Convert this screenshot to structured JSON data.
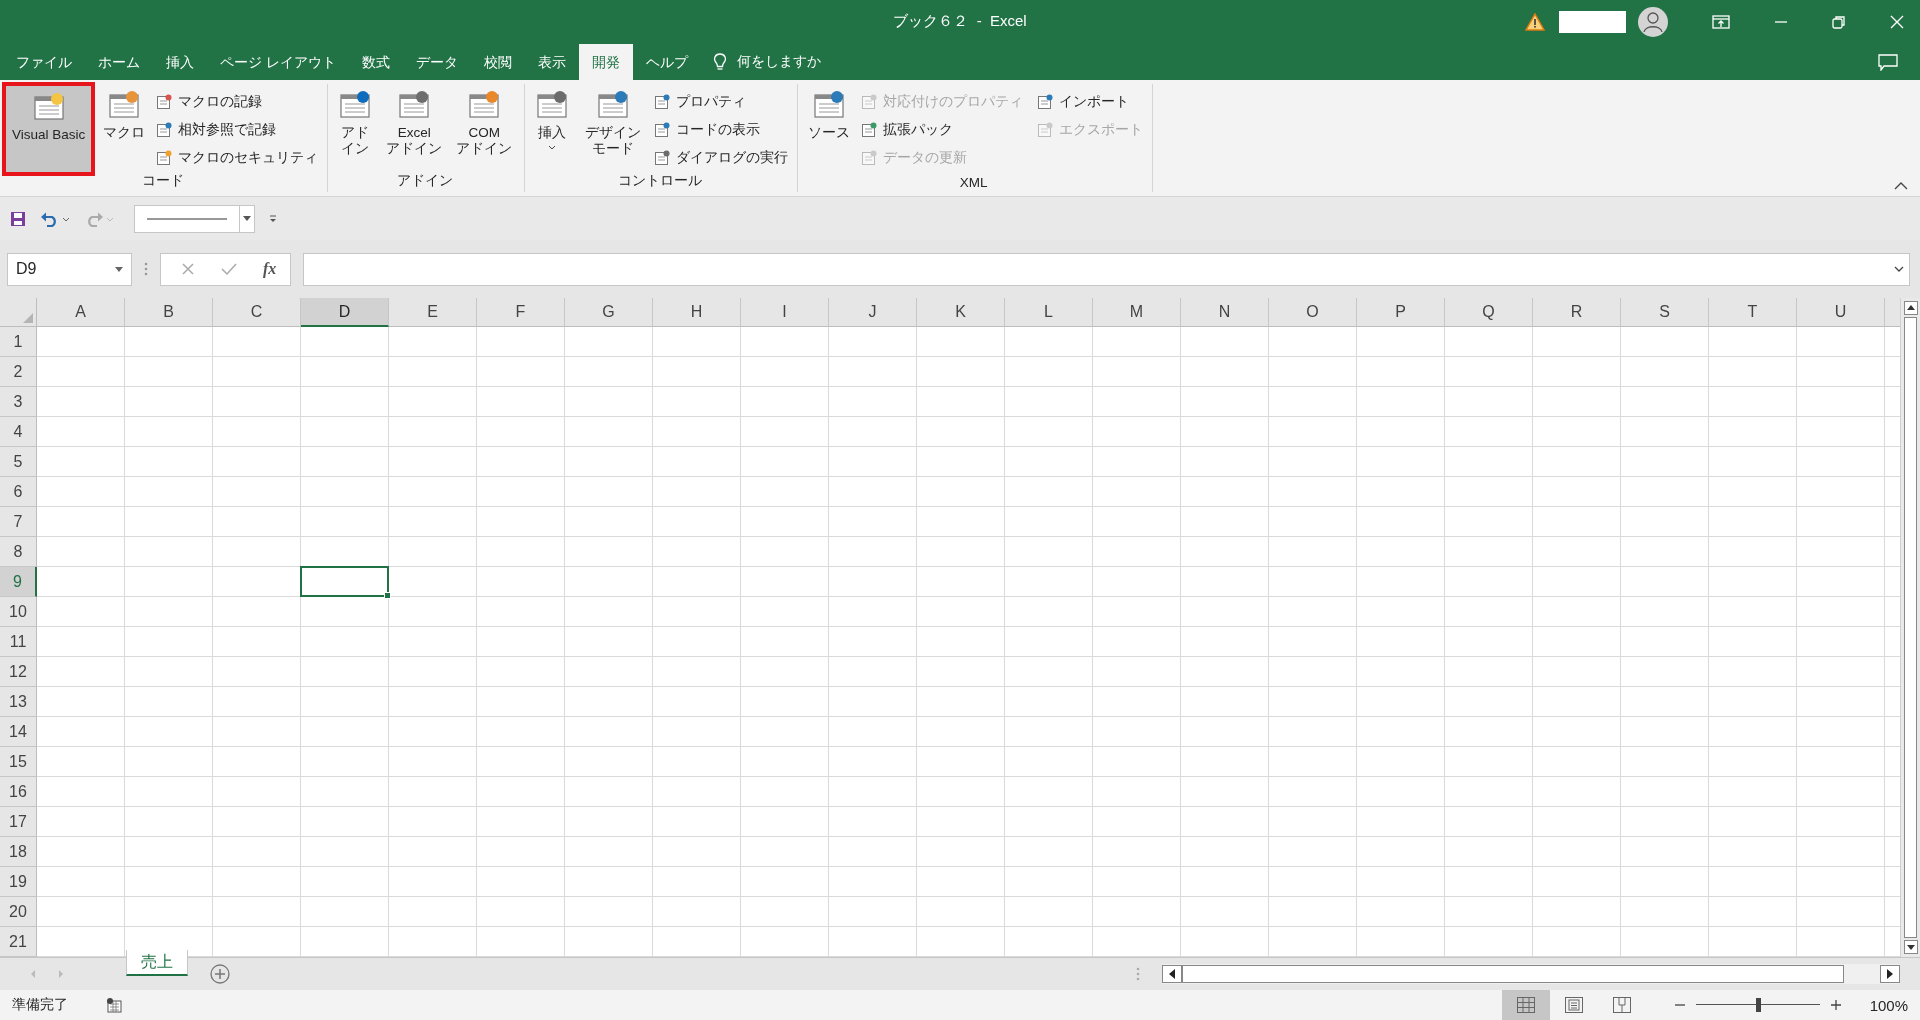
{
  "window": {
    "title": "ブック６２  -  Excel"
  },
  "tabs": [
    {
      "label": "ファイル",
      "selected": false
    },
    {
      "label": "ホーム",
      "selected": false
    },
    {
      "label": "挿入",
      "selected": false
    },
    {
      "label": "ページ レイアウト",
      "selected": false
    },
    {
      "label": "数式",
      "selected": false
    },
    {
      "label": "データ",
      "selected": false
    },
    {
      "label": "校閲",
      "selected": false
    },
    {
      "label": "表示",
      "selected": false
    },
    {
      "label": "開発",
      "selected": true
    },
    {
      "label": "ヘルプ",
      "selected": false
    }
  ],
  "tell_me": "何をしますか",
  "ribbon_groups": [
    {
      "label": "コード",
      "items": [
        {
          "kind": "large",
          "label": "Visual Basic",
          "highlighted": true,
          "disabled": false,
          "dropdown": false
        },
        {
          "kind": "large",
          "label": "マクロ",
          "highlighted": false,
          "disabled": false,
          "dropdown": false
        },
        {
          "kind": "small",
          "label": "マクロの記録",
          "highlighted": false,
          "disabled": false,
          "dropdown": false
        },
        {
          "kind": "small",
          "label": "相対参照で記録",
          "highlighted": false,
          "disabled": false,
          "dropdown": false
        },
        {
          "kind": "small",
          "label": "マクロのセキュリティ",
          "highlighted": false,
          "disabled": false,
          "dropdown": false
        }
      ]
    },
    {
      "label": "アドイン",
      "items": [
        {
          "kind": "large",
          "label": "アドイン",
          "highlighted": false,
          "disabled": false,
          "dropdown": false
        },
        {
          "kind": "large",
          "label": "Excel\nアドイン",
          "highlighted": false,
          "disabled": false,
          "dropdown": false
        },
        {
          "kind": "large",
          "label": "COM\nアドイン",
          "highlighted": false,
          "disabled": false,
          "dropdown": false
        }
      ]
    },
    {
      "label": "コントロール",
      "items": [
        {
          "kind": "large",
          "label": "挿入",
          "highlighted": false,
          "disabled": false,
          "dropdown": true
        },
        {
          "kind": "large",
          "label": "デザインモード",
          "highlighted": false,
          "disabled": false,
          "dropdown": false
        },
        {
          "kind": "small",
          "label": "プロパティ",
          "highlighted": false,
          "disabled": false,
          "dropdown": false
        },
        {
          "kind": "small",
          "label": "コードの表示",
          "highlighted": false,
          "disabled": false,
          "dropdown": false
        },
        {
          "kind": "small",
          "label": "ダイアログの実行",
          "highlighted": false,
          "disabled": false,
          "dropdown": false
        }
      ]
    },
    {
      "label": "XML",
      "items": [
        {
          "kind": "large",
          "label": "ソース",
          "highlighted": false,
          "disabled": false,
          "dropdown": false
        },
        {
          "kind": "small",
          "label": "対応付けのプロパティ",
          "highlighted": false,
          "disabled": true,
          "dropdown": false
        },
        {
          "kind": "small",
          "label": "拡張パック",
          "highlighted": false,
          "disabled": false,
          "dropdown": false
        },
        {
          "kind": "small",
          "label": "データの更新",
          "highlighted": false,
          "disabled": true,
          "dropdown": false
        },
        {
          "kind": "small",
          "label": "インポート",
          "highlighted": false,
          "disabled": false,
          "dropdown": false
        },
        {
          "kind": "small",
          "label": "エクスポート",
          "highlighted": false,
          "disabled": true,
          "dropdown": false
        }
      ]
    }
  ],
  "formula_bar": {
    "name_box": "D9",
    "fx": "fx"
  },
  "columns": [
    {
      "label": "A",
      "selected": false
    },
    {
      "label": "B",
      "selected": false
    },
    {
      "label": "C",
      "selected": false
    },
    {
      "label": "D",
      "selected": true
    },
    {
      "label": "E",
      "selected": false
    },
    {
      "label": "F",
      "selected": false
    },
    {
      "label": "G",
      "selected": false
    },
    {
      "label": "H",
      "selected": false
    },
    {
      "label": "I",
      "selected": false
    },
    {
      "label": "J",
      "selected": false
    },
    {
      "label": "K",
      "selected": false
    },
    {
      "label": "L",
      "selected": false
    },
    {
      "label": "M",
      "selected": false
    },
    {
      "label": "N",
      "selected": false
    },
    {
      "label": "O",
      "selected": false
    },
    {
      "label": "P",
      "selected": false
    },
    {
      "label": "Q",
      "selected": false
    },
    {
      "label": "R",
      "selected": false
    },
    {
      "label": "S",
      "selected": false
    },
    {
      "label": "T",
      "selected": false
    },
    {
      "label": "U",
      "selected": false
    }
  ],
  "rows": [
    {
      "label": "1",
      "selected": false
    },
    {
      "label": "2",
      "selected": false
    },
    {
      "label": "3",
      "selected": false
    },
    {
      "label": "4",
      "selected": false
    },
    {
      "label": "5",
      "selected": false
    },
    {
      "label": "6",
      "selected": false
    },
    {
      "label": "7",
      "selected": false
    },
    {
      "label": "8",
      "selected": false
    },
    {
      "label": "9",
      "selected": true
    },
    {
      "label": "10",
      "selected": false
    },
    {
      "label": "11",
      "selected": false
    },
    {
      "label": "12",
      "selected": false
    },
    {
      "label": "13",
      "selected": false
    },
    {
      "label": "14",
      "selected": false
    },
    {
      "label": "15",
      "selected": false
    },
    {
      "label": "16",
      "selected": false
    },
    {
      "label": "17",
      "selected": false
    },
    {
      "label": "18",
      "selected": false
    },
    {
      "label": "19",
      "selected": false
    },
    {
      "label": "20",
      "selected": false
    },
    {
      "label": "21",
      "selected": false
    }
  ],
  "sheets": [
    {
      "label": "売上",
      "selected": true
    }
  ],
  "status_bar": {
    "status": "準備完了",
    "views": [
      {
        "kind": "normal",
        "selected": true
      },
      {
        "kind": "page-layout",
        "selected": false
      },
      {
        "kind": "page-break",
        "selected": false
      }
    ],
    "zoom": {
      "level": 0.5,
      "reading": "100%"
    }
  }
}
